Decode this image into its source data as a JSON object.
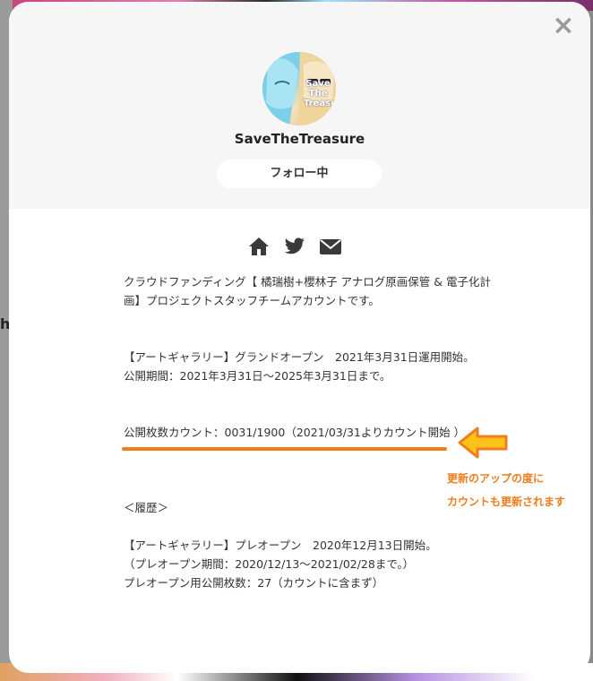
{
  "profile": {
    "name": "SaveTheTreasure",
    "follow_label": "フォロー中",
    "avatar_caption": "Save The Treasures!"
  },
  "close_label": "×",
  "links": {
    "home_icon": "home-icon",
    "twitter_icon": "twitter-icon",
    "mail_icon": "mail-icon"
  },
  "description": {
    "intro_line1": "クラウドファンディング【 橘瑞樹+櫻林子 アナログ原画保管 & 電子化計",
    "intro_line2": "画】プロジェクトスタッフチームアカウントです。",
    "gallery_open": "【アートギャラリー】グランドオープン　2021年3月31日運用開始。",
    "public_period": "公開期間：2021年3月31日～2025年3月31日まで。",
    "count": "公開枚数カウント：0031/1900（2021/03/31よりカウント開始 ）",
    "history_title": "＜履歴＞",
    "pre_open": "【アートギャラリー】プレオープン　2020年12月13日開始。",
    "pre_open_period": "（プレオープン期間：2020/12/13～2021/02/28まで。）",
    "pre_open_count": "プレオープン用公開枚数：27（カウントに含まず）"
  },
  "annotation": {
    "line1": "更新のアップの度に",
    "line2": "カウントも更新されます"
  },
  "background": {
    "left_text": "h"
  },
  "colors": {
    "accent": "#f07c1d",
    "arrow_fill": "#ffc21a",
    "header_bg": "#f6f6f6"
  }
}
